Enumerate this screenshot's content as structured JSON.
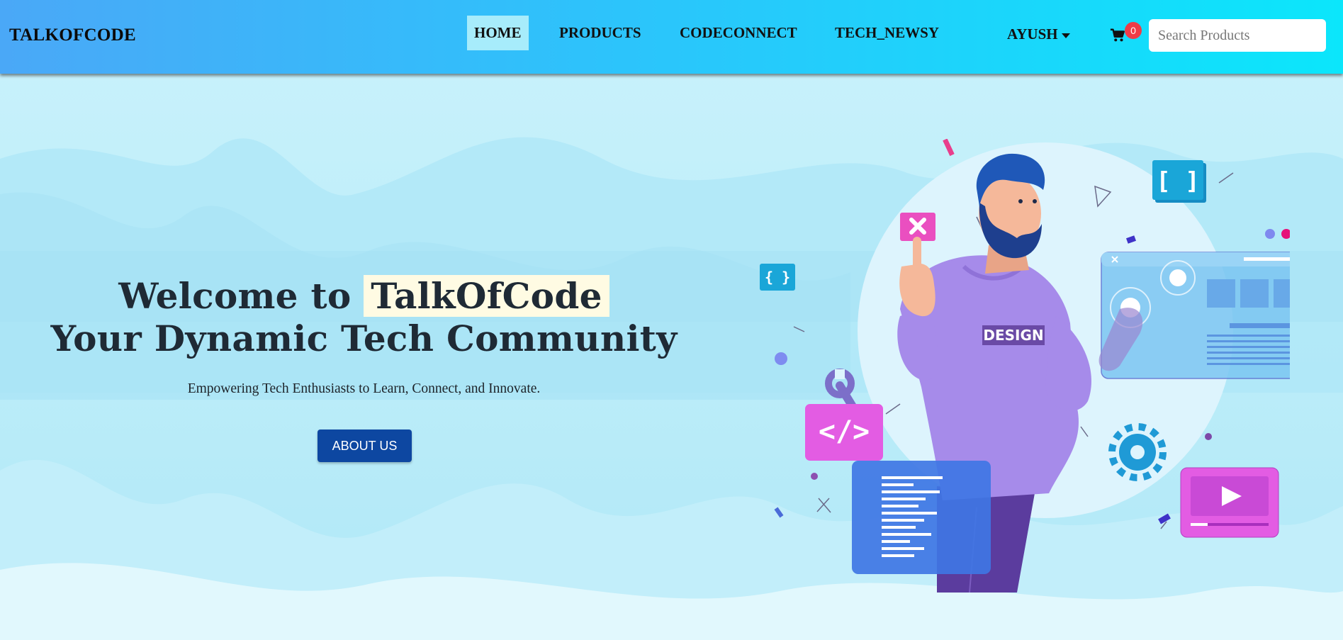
{
  "navbar": {
    "brand": "TALKOFCODE",
    "links": [
      "HOME",
      "PRODUCTS",
      "CODECONNECT",
      "TECH_NEWSY"
    ],
    "active_link": "HOME",
    "user": "AYUSH",
    "cart_count": "0",
    "search_placeholder": "Search Products"
  },
  "hero": {
    "title_prefix": "Welcome to",
    "title_highlight": "TalkOfCode",
    "title_line2": "Your Dynamic Tech Community",
    "subtitle": "Empowering Tech Enthusiasts to Learn, Connect, and Innovate.",
    "cta_label": "ABOUT US"
  },
  "illustration": {
    "shirt_text": "DESIGN",
    "code_badge": "</>",
    "bracket_badge": "[ ]",
    "small_bracket_badge": "{ }"
  },
  "colors": {
    "navbar_start": "#4aa8f7",
    "navbar_end": "#0be6fb",
    "cta_background": "#0d47a1",
    "title_highlight_bg": "#fffbe3",
    "cart_badge": "#ef3b47"
  },
  "icons": [
    "cart-icon",
    "caret-down-icon",
    "play-icon",
    "gear-icon",
    "wrench-icon",
    "close-icon"
  ]
}
